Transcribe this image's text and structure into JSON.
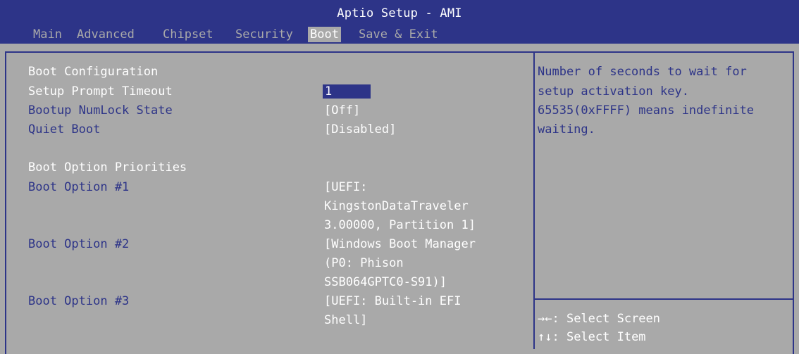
{
  "title": "Aptio Setup - AMI",
  "tabs": [
    "Main",
    "Advanced",
    "Chipset",
    "Security",
    "Boot",
    "Save & Exit"
  ],
  "active_tab": "Boot",
  "boot_configuration": {
    "header": "Boot Configuration",
    "setup_prompt_timeout": {
      "label": "Setup Prompt Timeout",
      "value": "1"
    },
    "bootup_numlock_state": {
      "label": "Bootup NumLock State",
      "value": "[Off]"
    },
    "quiet_boot": {
      "label": "Quiet Boot",
      "value": "[Disabled]"
    }
  },
  "boot_option_priorities": {
    "header": "Boot Option Priorities",
    "options": [
      {
        "label": "Boot Option #1",
        "value_lines": [
          "[UEFI:",
          "KingstonDataTraveler",
          "3.00000, Partition 1]"
        ]
      },
      {
        "label": "Boot Option #2",
        "value_lines": [
          "[Windows Boot Manager",
          "(P0: Phison",
          "SSB064GPTC0-S91)]"
        ]
      },
      {
        "label": "Boot Option #3",
        "value_lines": [
          "[UEFI: Built-in EFI",
          "Shell]"
        ]
      }
    ]
  },
  "help": {
    "lines": [
      "Number of seconds to wait for",
      "setup activation key.",
      "65535(0xFFFF) means indefinite",
      "waiting."
    ]
  },
  "key_help": [
    {
      "key": "→←",
      "action": ": Select Screen"
    },
    {
      "key": "↑↓",
      "action": ": Select Item"
    }
  ],
  "colors": {
    "accent": "#2d3488",
    "background": "#a9a9a9",
    "highlight_text": "#ffffff"
  }
}
